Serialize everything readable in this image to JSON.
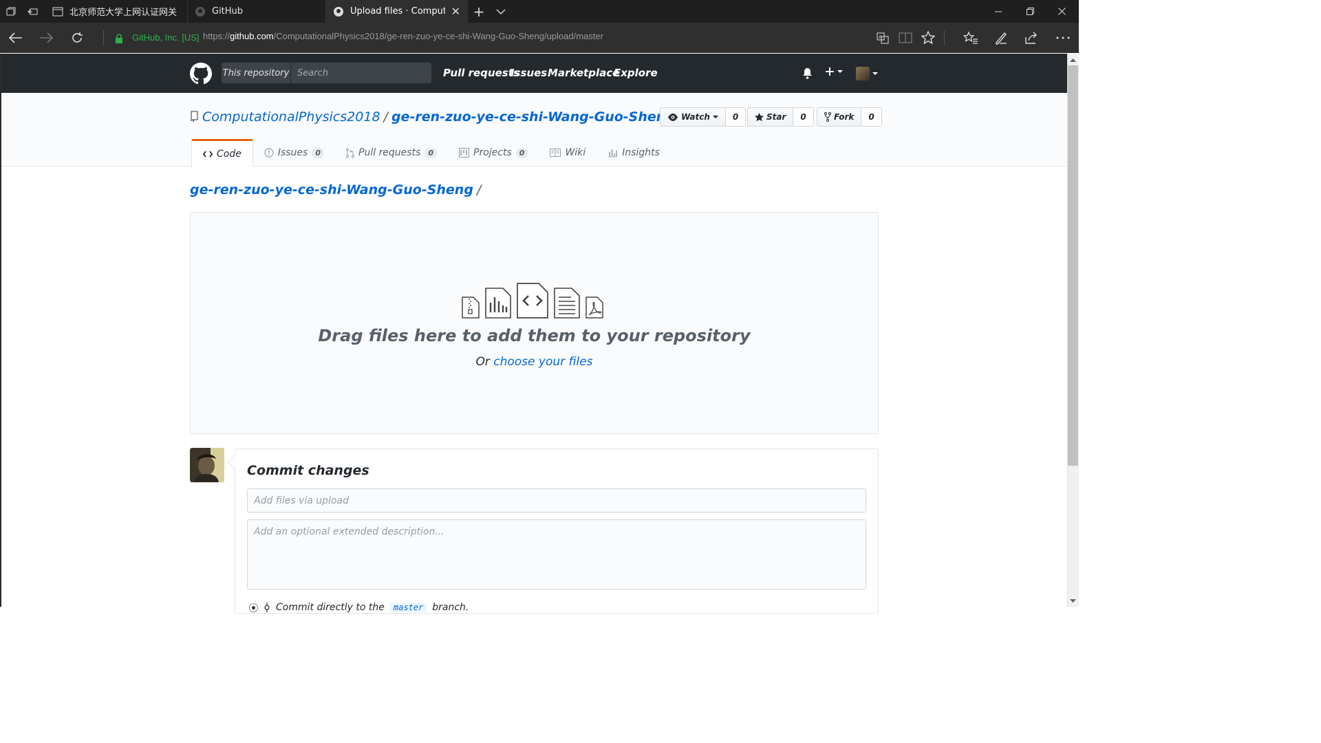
{
  "browser": {
    "tabs": [
      {
        "title": "北京师范大学上网认证网关",
        "active": false
      },
      {
        "title": "GitHub",
        "active": false
      },
      {
        "title": "Upload files · Computat",
        "active": true
      }
    ],
    "cert_label": "GitHub, Inc. [US]",
    "url_prefix": "https://",
    "url_host": "github.com",
    "url_path": "/ComputationalPhysics2018/ge-ren-zuo-ye-ce-shi-Wang-Guo-Sheng/upload/master"
  },
  "github": {
    "search_scope": "This repository",
    "search_placeholder": "Search",
    "nav": [
      "Pull requests",
      "Issues",
      "Marketplace",
      "Explore"
    ]
  },
  "repo": {
    "owner": "ComputationalPhysics2018",
    "separator": "/",
    "name": "ge-ren-zuo-ye-ce-shi-Wang-Guo-Sheng",
    "actions": {
      "watch": {
        "label": "Watch",
        "count": "0"
      },
      "star": {
        "label": "Star",
        "count": "0"
      },
      "fork": {
        "label": "Fork",
        "count": "0"
      }
    },
    "tabs": {
      "code": {
        "label": "Code"
      },
      "issues": {
        "label": "Issues",
        "count": "0"
      },
      "pulls": {
        "label": "Pull requests",
        "count": "0"
      },
      "projects": {
        "label": "Projects",
        "count": "0"
      },
      "wiki": {
        "label": "Wiki"
      },
      "insights": {
        "label": "Insights"
      }
    }
  },
  "breadcrumb": {
    "repo_link": "ge-ren-zuo-ye-ce-shi-Wang-Guo-Sheng",
    "slash": "/"
  },
  "dropzone": {
    "headline": "Drag files here to add them to your repository",
    "or_text": "Or",
    "choose_link": "choose your files"
  },
  "commit": {
    "heading": "Commit changes",
    "summary_placeholder": "Add files via upload",
    "description_placeholder": "Add an optional extended description...",
    "option_text_a": "Commit directly to the",
    "branch": "master",
    "option_text_b": "branch."
  },
  "colors": {
    "accent_link": "#0366d6",
    "header_bg": "#24292e",
    "selected_tab": "#e36209"
  }
}
